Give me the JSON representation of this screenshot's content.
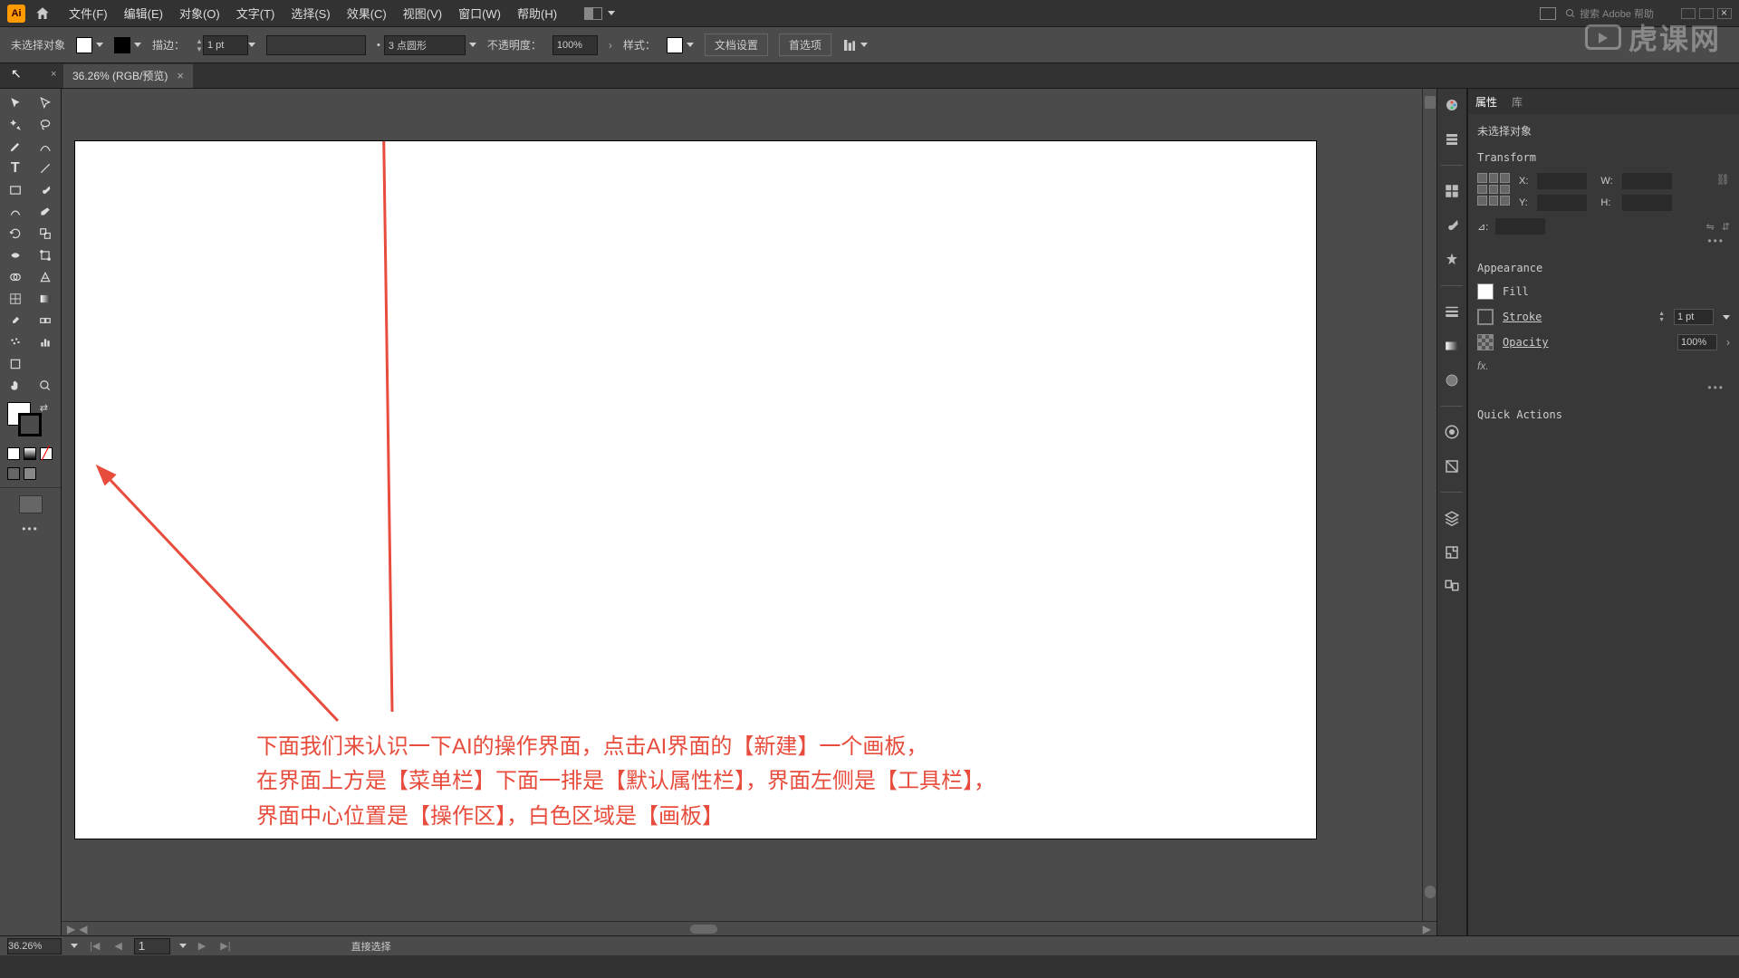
{
  "menubar": {
    "items": [
      "文件(F)",
      "编辑(E)",
      "对象(O)",
      "文字(T)",
      "选择(S)",
      "效果(C)",
      "视图(V)",
      "窗口(W)",
      "帮助(H)"
    ],
    "search_placeholder": "搜索 Adobe 帮助"
  },
  "controlbar": {
    "no_selection": "未选择对象",
    "stroke_label": "描边：",
    "stroke_value": "1 pt",
    "brush_value": "3 点圆形",
    "opacity_label": "不透明度：",
    "opacity_value": "100%",
    "style_label": "样式：",
    "doc_setup": "文档设置",
    "prefs": "首选项"
  },
  "tab": {
    "title": "36.26% (RGB/预览)"
  },
  "props": {
    "tab_properties": "属性",
    "tab_library": "库",
    "no_selection": "未选择对象",
    "transform_title": "Transform",
    "x_label": "X:",
    "y_label": "Y:",
    "w_label": "W:",
    "h_label": "H:",
    "angle_label": "⊿:",
    "appearance_title": "Appearance",
    "fill_label": "Fill",
    "stroke_label": "Stroke",
    "stroke_value": "1 pt",
    "opacity_label": "Opacity",
    "opacity_value": "100%",
    "fx_label": "fx.",
    "quick_actions": "Quick Actions"
  },
  "statusbar": {
    "zoom": "36.26%",
    "artboard_num": "1",
    "tool_hint": "直接选择"
  },
  "annotations": {
    "line1": "下面我们来认识一下AI的操作界面，点击AI界面的【新建】一个画板，",
    "line2": "在界面上方是【菜单栏】下面一排是【默认属性栏】，界面左侧是【工具栏】，",
    "line3": "界面中心位置是【操作区】，白色区域是【画板】"
  },
  "watermark": "虎课网"
}
